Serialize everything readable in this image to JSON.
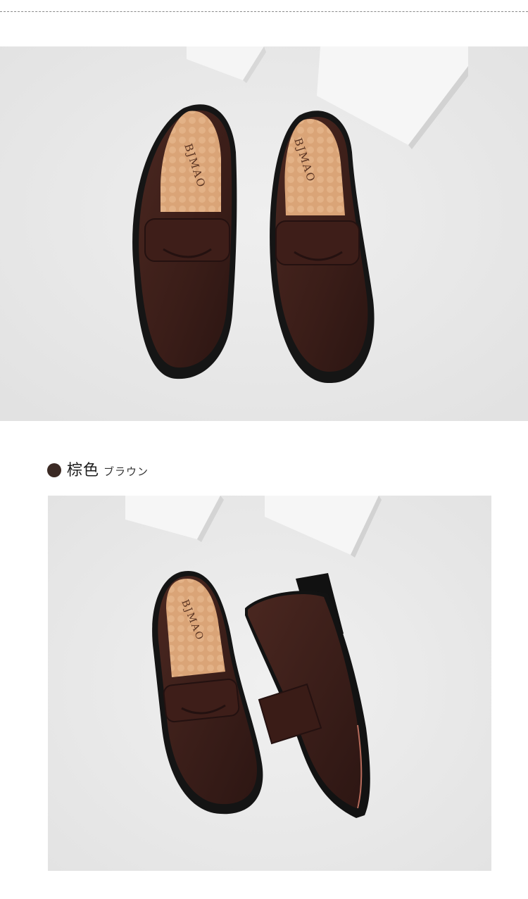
{
  "product_gallery": {
    "top_photo": {
      "insole_brand": "BJMAO"
    },
    "color_option": {
      "name": "棕色",
      "subtitle": "ブラウン",
      "swatch_color": "#3b2a24"
    },
    "bottom_photo": {
      "insole_brand": "BJMAO"
    }
  },
  "colors": {
    "leather": "#3a1f19",
    "insole": "#d9a276",
    "sole": "#121212",
    "background": "#ebebeb",
    "block": "#f4f4f4"
  }
}
